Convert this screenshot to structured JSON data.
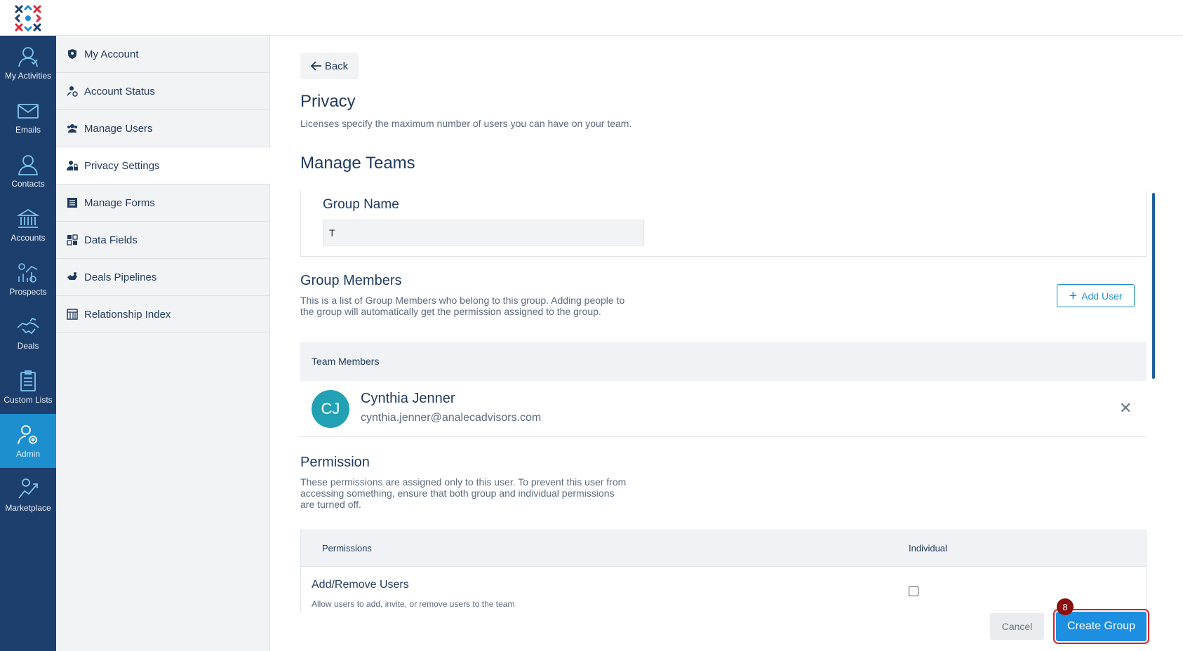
{
  "rail": {
    "items": [
      {
        "label": "My Activities",
        "icon": "user-activity-icon"
      },
      {
        "label": "Emails",
        "icon": "envelope-icon"
      },
      {
        "label": "Contacts",
        "icon": "contact-icon"
      },
      {
        "label": "Accounts",
        "icon": "bank-icon"
      },
      {
        "label": "Prospects",
        "icon": "prospects-chart-icon"
      },
      {
        "label": "Deals",
        "icon": "handshake-icon"
      },
      {
        "label": "Custom Lists",
        "icon": "clipboard-list-icon"
      },
      {
        "label": "Admin",
        "icon": "admin-gear-user-icon"
      },
      {
        "label": "Marketplace",
        "icon": "marketplace-icon"
      }
    ],
    "active": "Admin"
  },
  "subnav": {
    "items": [
      {
        "label": "My Account",
        "icon": "shield-user-icon"
      },
      {
        "label": "Account Status",
        "icon": "user-status-icon"
      },
      {
        "label": "Manage Users",
        "icon": "users-icon"
      },
      {
        "label": "Privacy Settings",
        "icon": "user-lock-icon"
      },
      {
        "label": "Manage Forms",
        "icon": "form-list-icon"
      },
      {
        "label": "Data Fields",
        "icon": "data-fields-icon"
      },
      {
        "label": "Deals Pipelines",
        "icon": "pipeline-icon"
      },
      {
        "label": "Relationship Index",
        "icon": "index-table-icon"
      }
    ],
    "active": "Privacy Settings"
  },
  "main": {
    "back_label": "Back",
    "title": "Privacy",
    "subtitle": "Licenses specify the maximum number of users you can have on your team.",
    "section_title": "Manage Teams",
    "group_name_label": "Group Name",
    "group_name_value": "T",
    "members_title": "Group Members",
    "members_desc": "This is a list of Group Members who belong to this group. Adding people to the group will automatically get the permission assigned to the group.",
    "add_user_label": "Add User",
    "team_header": "Team Members",
    "members": [
      {
        "initials": "CJ",
        "name": "Cynthia Jenner",
        "email": "cynthia.jenner@analecadvisors.com"
      }
    ],
    "permission_title": "Permission",
    "permission_desc": "These permissions are assigned only to this user. To prevent this user from accessing something, ensure that both group and individual permissions are turned off.",
    "perm_columns": [
      "Permissions",
      "Individual"
    ],
    "permissions": [
      {
        "title": "Add/Remove Users",
        "desc": "Allow users to add, invite, or remove users to the team",
        "individual": false
      }
    ]
  },
  "footer": {
    "cancel_label": "Cancel",
    "create_label": "Create Group",
    "step_badge": "8"
  },
  "colors": {
    "rail_bg": "#1c3f6e",
    "accent": "#1d8fe0",
    "highlight": "#e02020",
    "badge": "#8b0d0d",
    "avatar": "#22a1b4"
  }
}
